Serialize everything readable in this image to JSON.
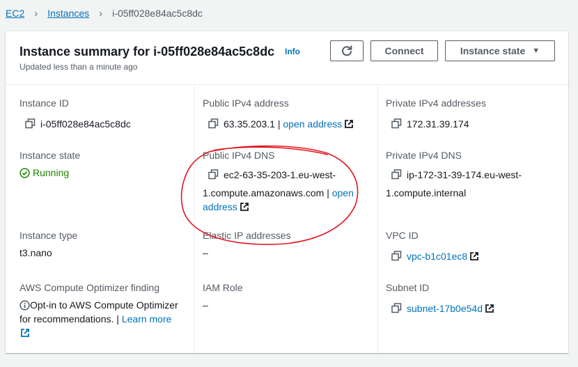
{
  "breadcrumb": {
    "root": "EC2",
    "instances": "Instances",
    "current": "i-05ff028e84ac5c8dc"
  },
  "summary": {
    "title": "Instance summary for i-05ff028e84ac5c8dc",
    "info": "Info",
    "updated": "Updated less than a minute ago",
    "refresh_icon": "refresh-icon",
    "connect": "Connect",
    "instance_state_button": "Instance state"
  },
  "details": {
    "instance_id": {
      "label": "Instance ID",
      "value": "i-05ff028e84ac5c8dc"
    },
    "public_ipv4": {
      "label": "Public IPv4 address",
      "value": "63.35.203.1",
      "separator": " | ",
      "link": "open address"
    },
    "private_ipv4": {
      "label": "Private IPv4 addresses",
      "value": "172.31.39.174"
    },
    "instance_state": {
      "label": "Instance state",
      "value": "Running"
    },
    "public_dns": {
      "label": "Public IPv4 DNS",
      "line1": "ec2-63-35-203-1.eu-west-",
      "line2": "1.compute.amazonaws.com",
      "separator": " | ",
      "link_part1": "open",
      "link_part2": "address"
    },
    "private_dns": {
      "label": "Private IPv4 DNS",
      "line1": "ip-172-31-39-174.eu-west-",
      "line2": "1.compute.internal"
    },
    "instance_type": {
      "label": "Instance type",
      "value": "t3.nano"
    },
    "elastic_ip": {
      "label": "Elastic IP addresses",
      "value": "–"
    },
    "vpc_id": {
      "label": "VPC ID",
      "value": "vpc-b1c01ec8"
    },
    "optimizer": {
      "label": "AWS Compute Optimizer finding",
      "line1": "Opt-in to AWS Compute Optimizer",
      "line2": "for recommendations.",
      "separator": " | ",
      "link": "Learn more"
    },
    "iam_role": {
      "label": "IAM Role",
      "value": "–"
    },
    "subnet_id": {
      "label": "Subnet ID",
      "value": "subnet-17b0e54d"
    }
  },
  "colors": {
    "link": "#0073bb",
    "running": "#1d8102",
    "annotation": "#e0141e",
    "text": "#16191f",
    "label": "#545b64"
  }
}
